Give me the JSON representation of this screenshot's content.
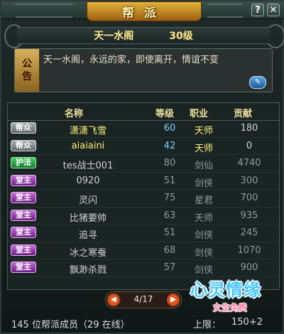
{
  "window": {
    "title": "帮派",
    "help_label": "?",
    "close_label": "✕"
  },
  "guild": {
    "name": "天一水阁",
    "level": "30级"
  },
  "notice": {
    "tag_line1": "公",
    "tag_line2": "告",
    "text": "天一水阁，永远的家，即使离开，情谊不变",
    "edit_icon": "edit-icon"
  },
  "table": {
    "headers": {
      "name": "名称",
      "level": "等级",
      "job": "职业",
      "contribution": "贡献"
    },
    "rows": [
      {
        "rank": "帮众",
        "rank_type": "bangzhong",
        "name": "潇潇飞雪",
        "level": "60",
        "job": "天师",
        "contribution": "180",
        "highlight": true
      },
      {
        "rank": "帮众",
        "rank_type": "bangzhong",
        "name": "aiaiaini",
        "level": "42",
        "job": "天师",
        "contribution": "0",
        "highlight": true
      },
      {
        "rank": "护法",
        "rank_type": "hufa",
        "name": "tes战士001",
        "level": "80",
        "job": "剑仙",
        "contribution": "4740",
        "highlight": false
      },
      {
        "rank": "堂主",
        "rank_type": "tangzhu",
        "name": "0920",
        "level": "51",
        "job": "剑侠",
        "contribution": "300",
        "highlight": false
      },
      {
        "rank": "堂主",
        "rank_type": "tangzhu",
        "name": "灵闪",
        "level": "75",
        "job": "星君",
        "contribution": "700",
        "highlight": false
      },
      {
        "rank": "堂主",
        "rank_type": "tangzhu",
        "name": "比猪要帅",
        "level": "63",
        "job": "天师",
        "contribution": "935",
        "highlight": false
      },
      {
        "rank": "堂主",
        "rank_type": "tangzhu",
        "name": "追寻",
        "level": "51",
        "job": "剑侠",
        "contribution": "245",
        "highlight": false
      },
      {
        "rank": "堂主",
        "rank_type": "tangzhu",
        "name": "冰之寒蚕",
        "level": "68",
        "job": "剑侠",
        "contribution": "1070",
        "highlight": false
      },
      {
        "rank": "堂主",
        "rank_type": "tangzhu",
        "name": "飘渺杀戮",
        "level": "57",
        "job": "剑侠",
        "contribution": "900",
        "highlight": false
      }
    ]
  },
  "pager": {
    "text": "4/17",
    "prev_icon": "prev-arrow-icon",
    "next_icon": "next-arrow-icon"
  },
  "footer": {
    "members": "145 位帮派成员（29  在线）",
    "limit": "上限：",
    "limit_value": "150+2"
  },
  "watermark": {
    "main": "心灵情缘",
    "sub": "女生免费"
  }
}
